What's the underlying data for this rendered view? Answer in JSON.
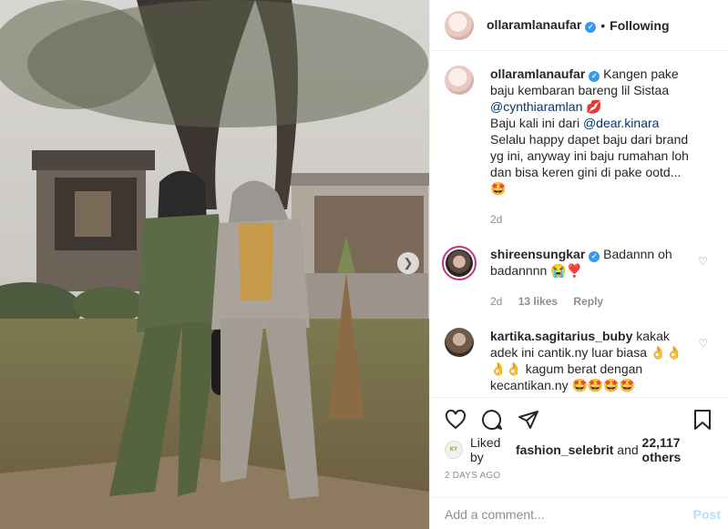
{
  "post": {
    "username": "ollaramlanaufar",
    "follow_status": "Following",
    "separator": "•"
  },
  "caption": {
    "username": "ollaramlanaufar",
    "line1": "Kangen pake baju kembaran bareng lil Sistaa",
    "mention1": "@cynthiaramlan",
    "emoji1": "💋",
    "line2": "Baju kali ini dari",
    "mention2": "@dear.kinara",
    "line3": "Selalu happy dapet baju dari brand yg ini, anyway ini baju rumahan loh dan bisa keren gini di pake ootd...",
    "emoji3": "🤩",
    "time": "2d"
  },
  "comments": [
    {
      "username": "shireensungkar",
      "text": "Badannn oh badannnn",
      "emoji": "😭❣️",
      "time": "2d",
      "likes": "13 likes",
      "reply": "Reply"
    },
    {
      "username": "kartika.sagitarius_buby",
      "text": "kakak adek ini cantik.ny luar biasa",
      "emoji_a": "👌👌👌👌",
      "text2": "kagum berat dengan kecantikan.ny",
      "emoji_b": "🤩🤩🤩🤩"
    }
  ],
  "likes": {
    "prefix": "Liked by",
    "user": "fashion_selebrit",
    "middle": "and",
    "count": "22,117 others",
    "avatar_text": "KY"
  },
  "date": "2 DAYS AGO",
  "add_comment": {
    "placeholder": "Add a comment...",
    "post_label": "Post"
  },
  "icons": {
    "verified": "verified-check-icon",
    "heart": "heart-icon",
    "comment": "comment-icon",
    "share": "paper-plane-icon",
    "save": "bookmark-icon",
    "next": "chevron-right-icon"
  }
}
